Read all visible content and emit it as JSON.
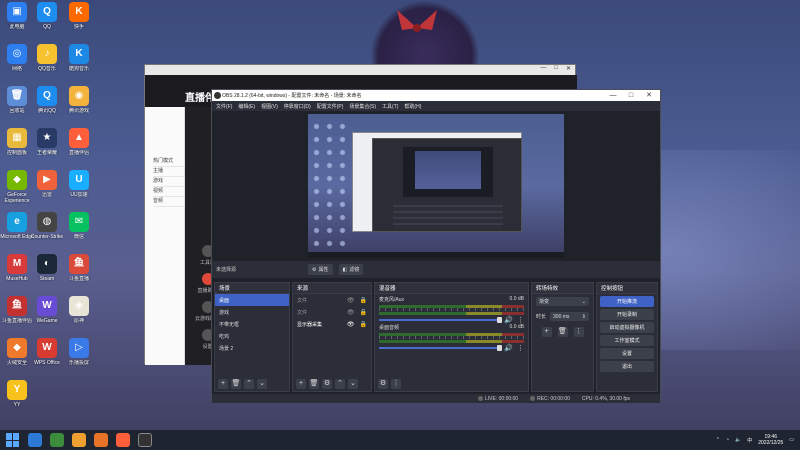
{
  "desktop": {
    "icons": [
      {
        "label": "此电脑",
        "color": "#2d7ff0",
        "glyph": "▣"
      },
      {
        "label": "QQ",
        "color": "#1e8df0",
        "glyph": "Q"
      },
      {
        "label": "快手",
        "color": "#ff6a00",
        "glyph": "K"
      },
      {
        "label": "网络",
        "color": "#2d7ff0",
        "glyph": "◎"
      },
      {
        "label": "QQ音乐",
        "color": "#f7c230",
        "glyph": "♪"
      },
      {
        "label": "酷狗音乐",
        "color": "#1e88e5",
        "glyph": "K"
      },
      {
        "label": "回收站",
        "color": "#5c8dd6",
        "glyph": "🗑"
      },
      {
        "label": "腾讯QQ",
        "color": "#1e8df0",
        "glyph": "Q"
      },
      {
        "label": "腾讯游戏",
        "color": "#f3b33d",
        "glyph": "◉"
      },
      {
        "label": "控制面板",
        "color": "#e8b93a",
        "glyph": "▦"
      },
      {
        "label": "王者荣耀",
        "color": "#2a3a66",
        "glyph": "★"
      },
      {
        "label": "直播伴侣",
        "color": "#ff5e3a",
        "glyph": "▲"
      },
      {
        "label": "GeForce Experience",
        "color": "#76b900",
        "glyph": "◆"
      },
      {
        "label": "迅雷",
        "color": "#f1623b",
        "glyph": "▶"
      },
      {
        "label": "UU加速",
        "color": "#19aeff",
        "glyph": "U"
      },
      {
        "label": "Microsoft Edge",
        "color": "#16a0e0",
        "glyph": "e"
      },
      {
        "label": "Counter-Strike",
        "color": "#444",
        "glyph": "◍"
      },
      {
        "label": "微信",
        "color": "#07c160",
        "glyph": "✉"
      },
      {
        "label": "MuseHub",
        "color": "#d93b3b",
        "glyph": "M"
      },
      {
        "label": "Steam",
        "color": "#1b2838",
        "glyph": "◐"
      },
      {
        "label": "斗鱼直播",
        "color": "#d94a3a",
        "glyph": "鱼"
      },
      {
        "label": "斗鱼直播伴侣",
        "color": "#c43131",
        "glyph": "鱼"
      },
      {
        "label": "WeGame",
        "color": "#6a4bd6",
        "glyph": "W"
      },
      {
        "label": "原神",
        "color": "#e8e4d6",
        "glyph": "◈"
      },
      {
        "label": "火绒安全",
        "color": "#ef7a2b",
        "glyph": "◆"
      },
      {
        "label": "WPS Office",
        "color": "#d83b2f",
        "glyph": "W"
      },
      {
        "label": "乐播投屏",
        "color": "#3a7ae8",
        "glyph": "▷"
      },
      {
        "label": "YY",
        "color": "#f7c21b",
        "glyph": "Y"
      }
    ]
  },
  "bg_window": {
    "logo": "直播伴侣",
    "list_items": [
      "热门模式",
      "主播",
      "游戏",
      "视频",
      "音频"
    ],
    "side_items": [
      "工具箱",
      "直播助手",
      "云游戏助手",
      "设置"
    ],
    "bottom": "直播伴侣"
  },
  "obs": {
    "title": "OBS 28.1.2 (64-bit, windows) - 配置文件: 未命名 - 场景: 未命名",
    "menu": [
      "文件(F)",
      "编辑(E)",
      "视图(V)",
      "停靠窗口(D)",
      "配置文件(P)",
      "场景集合(S)",
      "工具(T)",
      "帮助(H)"
    ],
    "source_label": "未选择源",
    "props_label": "属性",
    "filters_label": "滤镜",
    "scenes": {
      "title": "场景",
      "items": [
        "桌面",
        "游戏",
        "不带无框",
        "吃鸡",
        "场景 2"
      ],
      "selected": 0
    },
    "sources": {
      "title": "来源",
      "items": [
        {
          "label": "文件",
          "active": false
        },
        {
          "label": "文件",
          "active": false
        },
        {
          "label": "显示器采集",
          "active": true
        }
      ]
    },
    "mixer": {
      "title": "混音器",
      "channels": [
        {
          "name": "麦克风/Aux",
          "db": "0.0 dB"
        },
        {
          "name": "桌面音频",
          "db": "0.0 dB"
        }
      ]
    },
    "transitions": {
      "title": "转场特效",
      "type": "渐变",
      "duration_label": "时长",
      "duration": "300 ms"
    },
    "controls": {
      "title": "控制按钮",
      "buttons": [
        "开始推流",
        "开始录制",
        "启动虚拟摄像机",
        "工作室模式",
        "设置",
        "退出"
      ]
    },
    "status": {
      "live": "LIVE: 00:00:00",
      "rec": "REC: 00:00:00",
      "cpu": "CPU: 0.4%, 30.00 fps"
    }
  },
  "taskbar": {
    "time": "19:46",
    "date": "2022/12/25",
    "tray_lang": "中"
  }
}
